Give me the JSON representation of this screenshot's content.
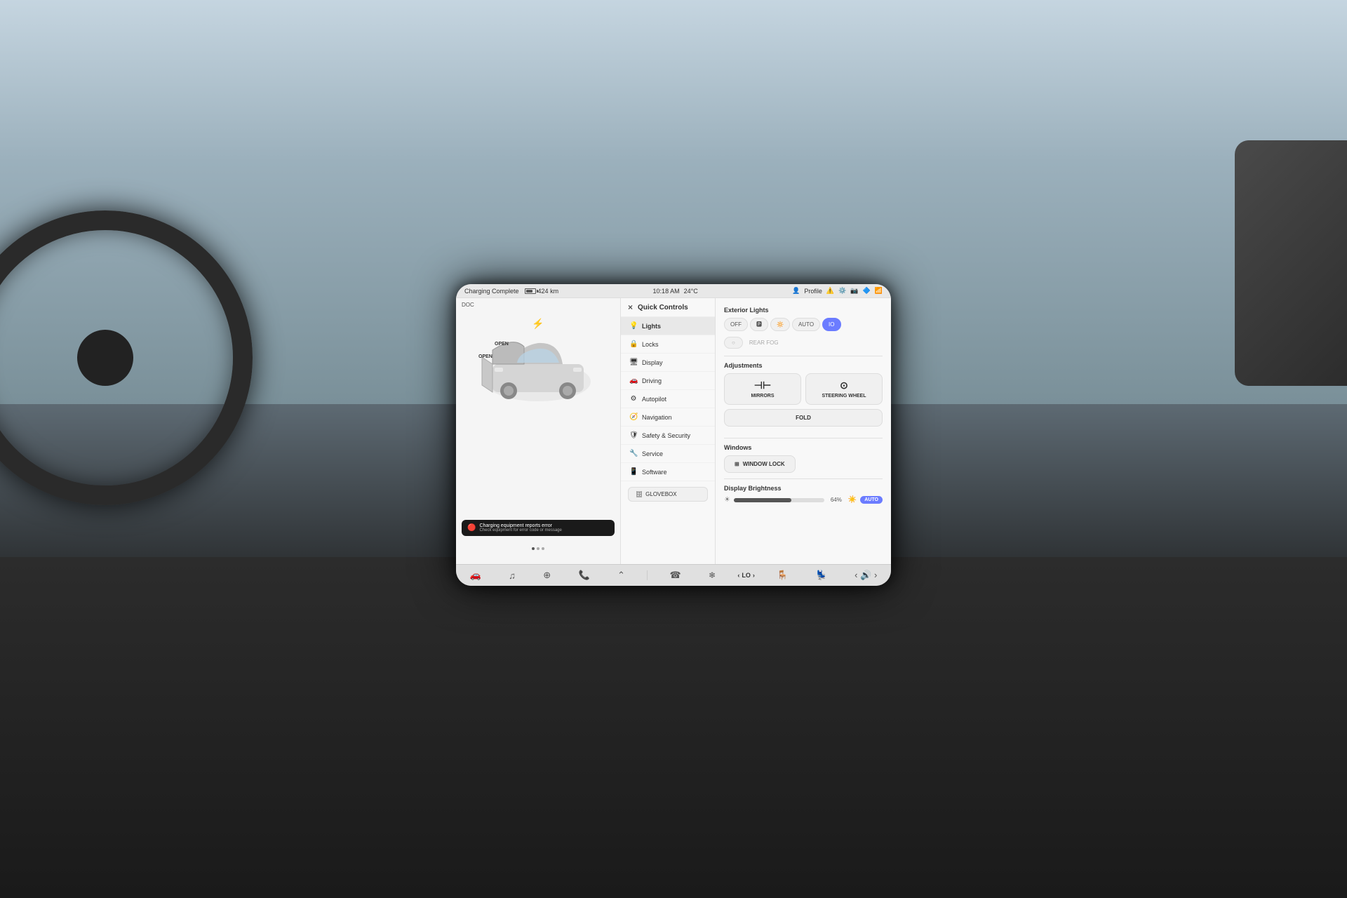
{
  "background": {
    "color": "#1a1a1a"
  },
  "statusBar": {
    "chargingStatus": "Charging Complete",
    "range": "424 km",
    "time": "10:18 AM",
    "temperature": "24°C",
    "profileLabel": "Profile"
  },
  "carView": {
    "docRange": "DOC",
    "openLabels": [
      "OPEN",
      "OPEN"
    ],
    "errorTitle": "Charging equipment reports error",
    "errorSubtitle": "Check equipment for error code or message"
  },
  "menu": {
    "closeLabel": "×",
    "headerLabel": "Quick Controls",
    "items": [
      {
        "id": "lights",
        "label": "Lights",
        "icon": "💡",
        "active": true
      },
      {
        "id": "locks",
        "label": "Locks",
        "icon": "🔒"
      },
      {
        "id": "display",
        "label": "Display",
        "icon": "📺"
      },
      {
        "id": "driving",
        "label": "Driving",
        "icon": "🚗"
      },
      {
        "id": "autopilot",
        "label": "Autopilot",
        "icon": "⚙️"
      },
      {
        "id": "navigation",
        "label": "Navigation",
        "icon": "🧭"
      },
      {
        "id": "safety",
        "label": "Safety & Security",
        "icon": "🛡️"
      },
      {
        "id": "service",
        "label": "Service",
        "icon": "🔧"
      },
      {
        "id": "software",
        "label": "Software",
        "icon": "📱"
      }
    ],
    "gloveboxLabel": "GLOVEBOX"
  },
  "controls": {
    "exteriorLights": {
      "title": "Exterior Lights",
      "buttons": [
        {
          "id": "off",
          "label": "OFF",
          "active": false
        },
        {
          "id": "parking",
          "label": "🅿",
          "active": false
        },
        {
          "id": "low",
          "label": "🔆",
          "active": false
        },
        {
          "id": "auto",
          "label": "AUTO",
          "active": false
        },
        {
          "id": "io",
          "label": "IO",
          "active": true
        }
      ]
    },
    "fogLights": {
      "frontLabel": "○",
      "rearLabel": "REAR FOG"
    },
    "adjustments": {
      "title": "Adjustments",
      "mirrorsLabel": "MIRRORS",
      "steeringLabel": "STEERING WHEEL",
      "foldLabel": "FOLD"
    },
    "windows": {
      "title": "Windows",
      "windowLockLabel": "WINDOW LOCK"
    },
    "displayBrightness": {
      "title": "Display Brightness",
      "percentage": "64%",
      "autoLabel": "AUTO"
    }
  },
  "bottomNav": {
    "items": [
      {
        "id": "car",
        "icon": "🚗",
        "active": true
      },
      {
        "id": "music",
        "icon": "🎵"
      },
      {
        "id": "apps",
        "icon": "⊕"
      },
      {
        "id": "phone",
        "icon": "📞"
      },
      {
        "id": "chevron",
        "icon": "⌃"
      }
    ],
    "rightItems": [
      {
        "id": "phone-call",
        "icon": "📞"
      },
      {
        "id": "fan",
        "icon": "❄️"
      },
      {
        "id": "lo-control",
        "label": "LO"
      },
      {
        "id": "seat",
        "icon": "🪑"
      },
      {
        "id": "seat2",
        "icon": "💺"
      },
      {
        "id": "volume",
        "icon": "🔊"
      }
    ]
  }
}
